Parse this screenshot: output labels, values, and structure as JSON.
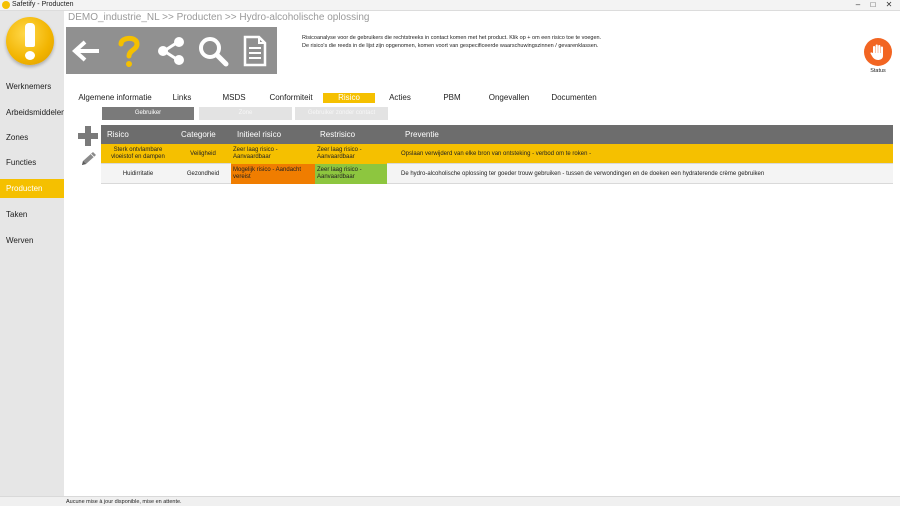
{
  "window": {
    "title": "Safetify - Producten"
  },
  "sidebar": {
    "items": [
      {
        "label": "Werknemers",
        "active": false
      },
      {
        "label": "Arbeidsmiddelen",
        "active": false
      },
      {
        "label": "Zones",
        "active": false
      },
      {
        "label": "Functies",
        "active": false
      },
      {
        "label": "Producten",
        "active": true
      },
      {
        "label": "Taken",
        "active": false
      },
      {
        "label": "Werven",
        "active": false
      }
    ]
  },
  "breadcrumb": "DEMO_industrie_NL >> Producten >> Hydro-alcoholische oplossing",
  "toolbar": {
    "icons": [
      "back-arrow-icon",
      "help-icon",
      "share-icon",
      "search-icon",
      "document-icon"
    ]
  },
  "info": {
    "line1": "Risicoanalyse voor de gebruikers die rechtstreeks in contact komen met het product.  Klik op + om een risico toe te voegen.",
    "line2": "De risico's die reeds in de lijst zijn opgenomen, komen voort van gespecificeerde waarschuwingszinnen / gevarenklassen."
  },
  "status": {
    "label": "Status"
  },
  "tabs": [
    {
      "label": "Algemene informatie"
    },
    {
      "label": "Links"
    },
    {
      "label": "MSDS"
    },
    {
      "label": "Conformiteit"
    },
    {
      "label": "Risico"
    },
    {
      "label": "Acties"
    },
    {
      "label": "PBM"
    },
    {
      "label": "Ongevallen"
    },
    {
      "label": "Documenten"
    }
  ],
  "subtabs": [
    {
      "label": "Gebruiker"
    },
    {
      "label": "Zone"
    },
    {
      "label": "Gebruiker zonder contact"
    }
  ],
  "table": {
    "headers": [
      "Risico",
      "Categorie",
      "Initieel risico",
      "Restrisico",
      "Preventie"
    ],
    "rows": [
      {
        "risico": "Sterk ontvlambare vloeistof en dampen",
        "categorie": "Veiligheid",
        "initieel": "Zeer laag risico - Aanvaardbaar",
        "rest": "Zeer laag risico - Aanvaardbaar",
        "preventie": "Opslaan verwijderd van elke bron van ontsteking - verbod om te roken -"
      },
      {
        "risico": "Huidirritatie",
        "categorie": "Gezondheid",
        "initieel": "Mogelijk risico - Aandacht vereist",
        "rest": "Zeer laag risico - Aanvaardbaar",
        "preventie": "De hydro-alcoholische oplossing ter goeder trouw gebruiken - tussen de verwondingen en de doeken een hydraterende crème gebruiken"
      }
    ]
  },
  "statusbar": "Aucune mise à jour disponible, mise en attente.",
  "colors": {
    "accent": "#f5c000",
    "toolbar": "#909090",
    "header": "#6d6d6d",
    "orange": "#f07d00",
    "green": "#8dc63f",
    "status": "#f26522"
  }
}
